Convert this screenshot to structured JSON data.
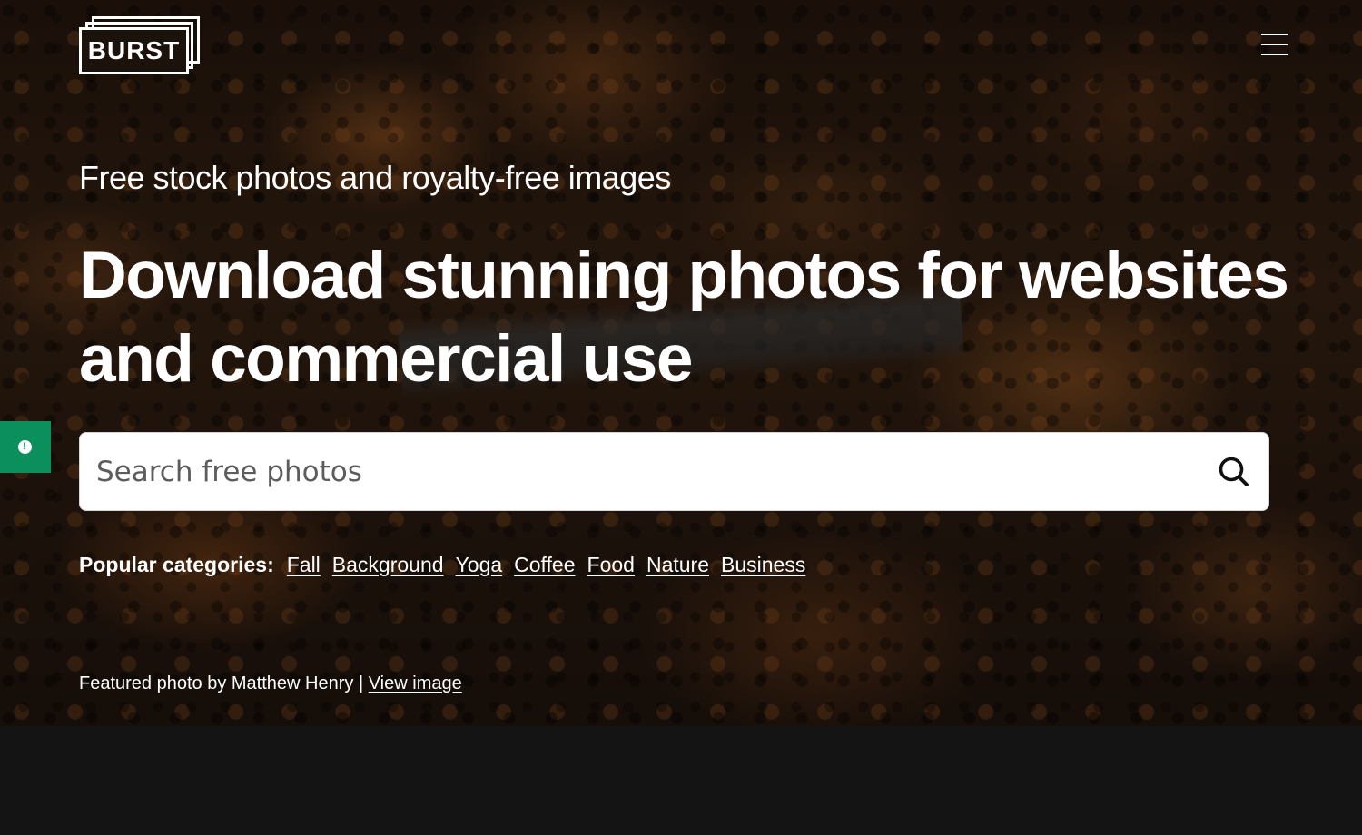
{
  "header": {
    "logo_text": "BURST",
    "menu_icon": "hamburger-menu-icon"
  },
  "hero": {
    "tagline": "Free stock photos and royalty-free images",
    "headline": "Download stunning photos for websites and commercial use"
  },
  "feedback": {
    "icon": "alert-circle-icon",
    "glyph": "!",
    "color": "#0b8f5c"
  },
  "search": {
    "placeholder": "Search free photos",
    "value": "",
    "icon": "search-icon"
  },
  "categories": {
    "label": "Popular categories:",
    "items": [
      "Fall",
      "Background",
      "Yoga",
      "Coffee",
      "Food",
      "Nature",
      "Business"
    ]
  },
  "credit": {
    "text": "Featured photo by Matthew Henry | ",
    "link_label": "View image"
  },
  "colors": {
    "page_background": "#141414",
    "accent": "#0b8f5c",
    "text": "#ffffff"
  }
}
